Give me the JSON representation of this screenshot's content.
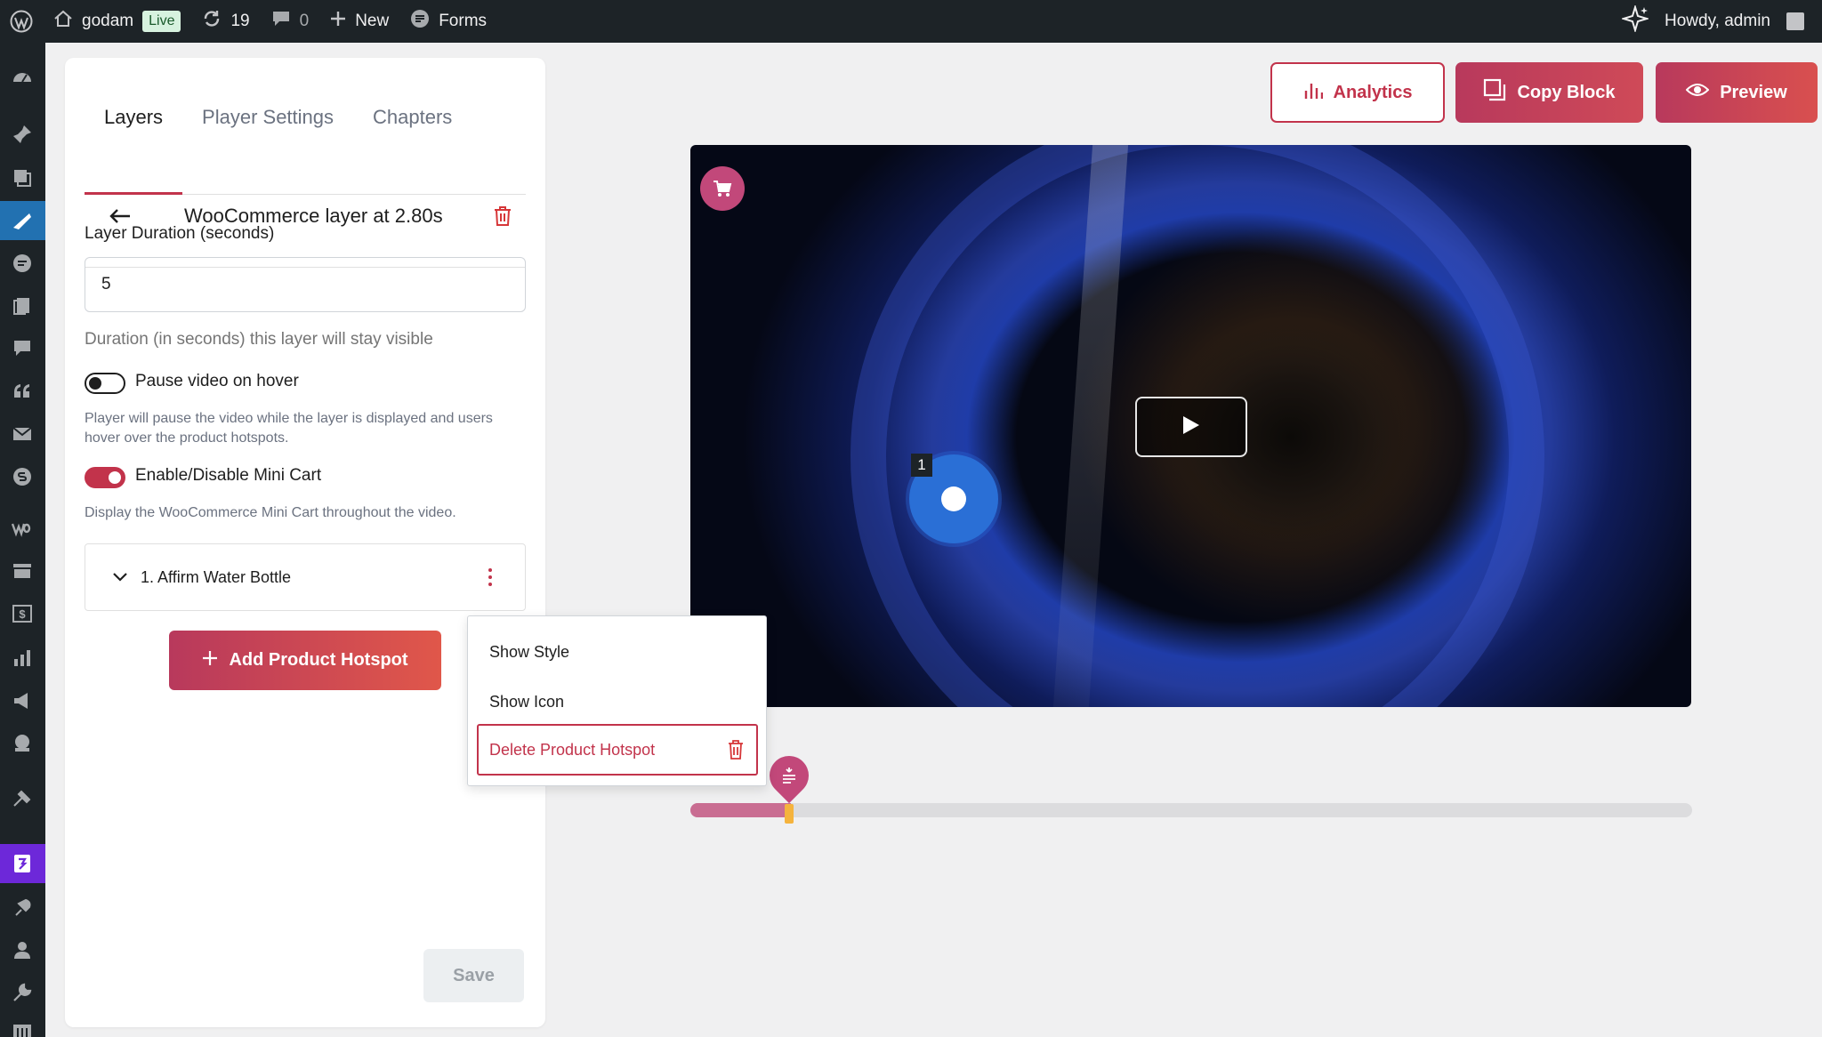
{
  "adminbar": {
    "site_name": "godam",
    "live_badge": "Live",
    "updates_count": "19",
    "comments_count": "0",
    "new_label": "New",
    "forms_label": "Forms",
    "howdy": "Howdy, admin"
  },
  "panel": {
    "tabs": [
      "Layers",
      "Player Settings",
      "Chapters"
    ],
    "layer_title": "WooCommerce layer at 2.80s",
    "duration_label": "Layer Duration (seconds)",
    "duration_value": "5",
    "duration_help": "Duration (in seconds) this layer will stay visible",
    "pause_label": "Pause video on hover",
    "pause_help": "Player will pause the video while the layer is displayed and users hover over the product hotspots.",
    "minicart_label": "Enable/Disable Mini Cart",
    "minicart_help": "Display the WooCommerce Mini Cart throughout the video.",
    "hotspot_item": "1. Affirm Water Bottle",
    "add_hotspot": "Add Product Hotspot",
    "save": "Save"
  },
  "dropdown": {
    "show_style": "Show Style",
    "show_icon": "Show Icon",
    "delete_hotspot": "Delete Product Hotspot"
  },
  "toolbar": {
    "analytics": "Analytics",
    "copy_block": "Copy Block",
    "preview": "Preview"
  },
  "video": {
    "hotspot_number": "1",
    "progress_fraction": 0.1
  },
  "colors": {
    "accent": "#c2334b",
    "wp_admin": "#1d2327",
    "hotspot": "#2a6fd6"
  }
}
